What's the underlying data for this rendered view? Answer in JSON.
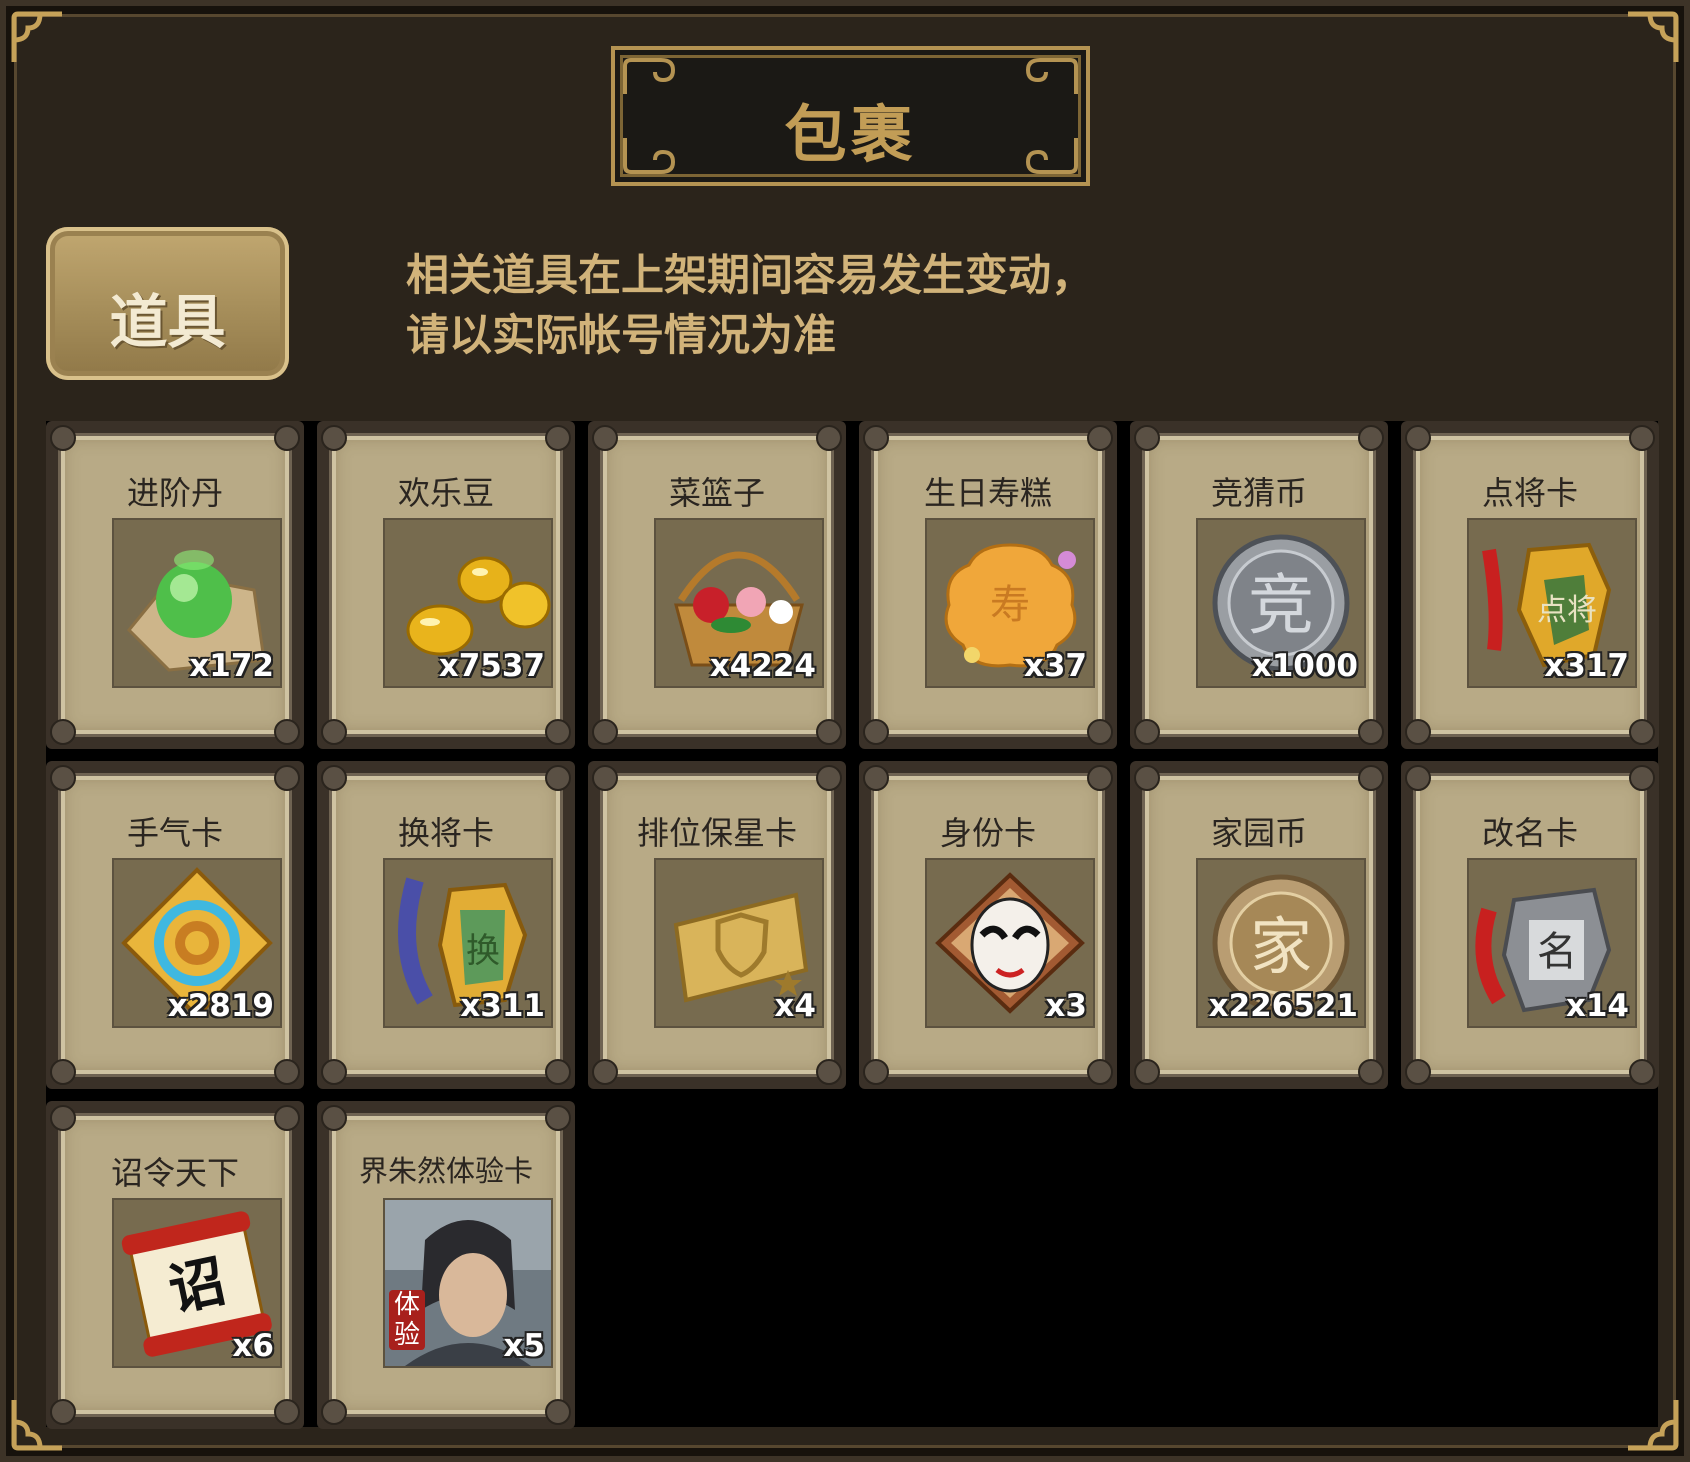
{
  "window": {
    "title": "包裹"
  },
  "tab": {
    "label": "道具"
  },
  "notice": {
    "line1": "相关道具在上架期间容易发生变动，",
    "line2": "请以实际帐号情况为准"
  },
  "items": [
    {
      "name": "进阶丹",
      "count": "x172",
      "icon": "green-orb-icon"
    },
    {
      "name": "欢乐豆",
      "count": "x7537",
      "icon": "gold-beans-icon"
    },
    {
      "name": "菜篮子",
      "count": "x4224",
      "icon": "flower-basket-icon"
    },
    {
      "name": "生日寿糕",
      "count": "x37",
      "icon": "birthday-cake-icon"
    },
    {
      "name": "竞猜币",
      "count": "x1000",
      "icon": "silver-coin-icon"
    },
    {
      "name": "点将卡",
      "count": "x317",
      "icon": "general-tag-icon"
    },
    {
      "name": "手气卡",
      "count": "x2819",
      "icon": "luck-card-icon"
    },
    {
      "name": "换将卡",
      "count": "x311",
      "icon": "swap-tag-icon"
    },
    {
      "name": "排位保星卡",
      "count": "x4",
      "icon": "shield-ticket-icon"
    },
    {
      "name": "身份卡",
      "count": "x3",
      "icon": "opera-mask-icon"
    },
    {
      "name": "家园币",
      "count": "x226521",
      "icon": "bronze-coin-icon"
    },
    {
      "name": "改名卡",
      "count": "x14",
      "icon": "name-tag-icon"
    },
    {
      "name": "诏令天下",
      "count": "x6",
      "icon": "edict-scroll-icon"
    },
    {
      "name": "界朱然体验卡",
      "count": "x5",
      "icon": "hero-portrait-icon",
      "badge": "体验"
    }
  ],
  "colors": {
    "frame": "#2b241b",
    "gold": "#c29d56",
    "card": "#b8aa86",
    "notice": "#d1b37a"
  }
}
